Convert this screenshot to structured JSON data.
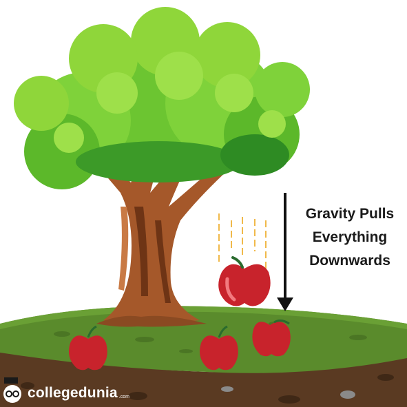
{
  "caption": {
    "lines": [
      "Gravity Pulls",
      "Everything",
      "Downwards"
    ]
  },
  "brand": {
    "name": "collegedunia",
    "tld": ".com",
    "icon": "mascot-glasses-icon"
  },
  "colors": {
    "foliage_light": "#8fd63a",
    "foliage_mid": "#5cb82a",
    "foliage_dark": "#2e8b23",
    "trunk": "#a5582a",
    "trunk_dark": "#6e3415",
    "grass": "#5a8b2c",
    "soil": "#5a3a22",
    "apple": "#c8232c",
    "arrow": "#111111",
    "motion_lines": "#f0b94a"
  }
}
